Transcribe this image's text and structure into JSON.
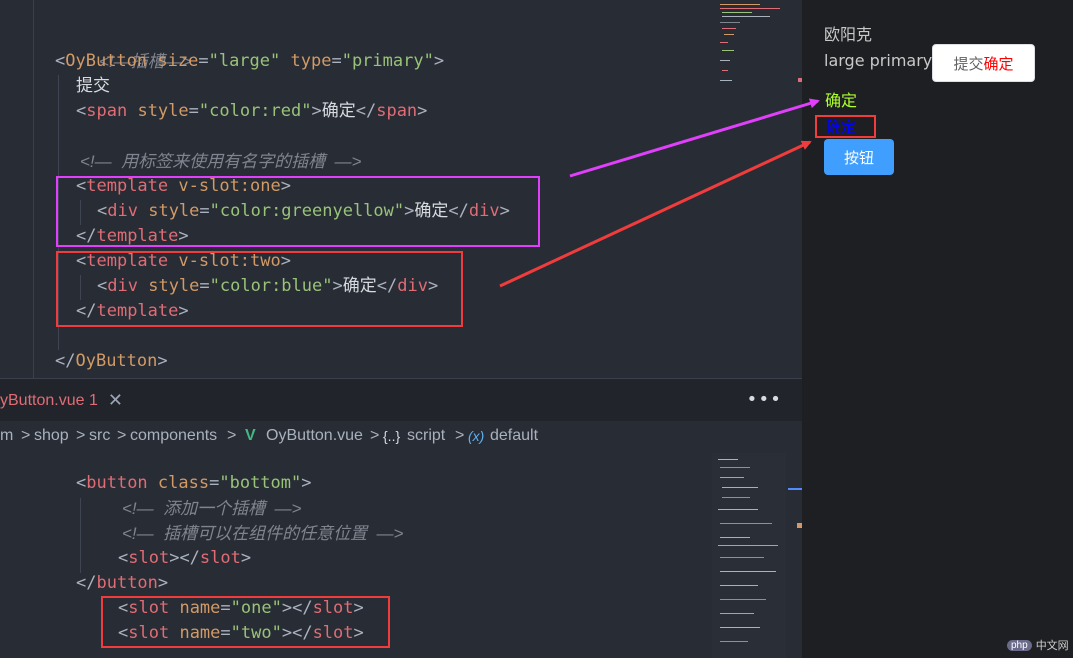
{
  "colors": {
    "tag": "#e06c75",
    "attr": "#d19a66",
    "string": "#98c379",
    "comment": "#7f848e",
    "magenta_box": "#e040fb",
    "red_box": "#f03c3c",
    "button_blue": "#409eff",
    "greenyellow": "#adff2f",
    "blue": "#0000ff"
  },
  "top_editor": {
    "lines": [
      {
        "cmt": "<!—插槽—>"
      },
      {
        "lt": "<",
        "tag": "OyButton",
        "a1": "size",
        "v1": "\"large\"",
        "a2": "type",
        "v2": "\"primary\"",
        "gt": ">"
      },
      {
        "text": "提交"
      },
      {
        "lt": "<",
        "tag": "span",
        "a1": "style",
        "v1": "\"color:red\"",
        "gt": ">",
        "text": "确定",
        "close_lt": "</",
        "close_tag": "span",
        "close_gt": ">"
      },
      {
        "cmt": "<!—  用标签来使用有名字的插槽  —>"
      },
      {
        "lt": "<",
        "tag": "template",
        "a1": "v-slot:one",
        "gt": ">"
      },
      {
        "lt": "<",
        "tag": "div",
        "a1": "style",
        "v1": "\"color:greenyellow\"",
        "gt": ">",
        "text": "确定",
        "close_lt": "</",
        "close_tag": "div",
        "close_gt": ">"
      },
      {
        "close_lt": "</",
        "close_tag": "template",
        "close_gt": ">"
      },
      {
        "lt": "<",
        "tag": "template",
        "a1": "v-slot:two",
        "gt": ">"
      },
      {
        "lt": "<",
        "tag": "div",
        "a1": "style",
        "v1": "\"color:blue\"",
        "gt": ">",
        "text": "确定",
        "close_lt": "</",
        "close_tag": "div",
        "close_gt": ">"
      },
      {
        "close_lt": "</",
        "close_tag": "template",
        "close_gt": ">"
      },
      {
        "close_lt": "</",
        "close_tag": "OyButton",
        "close_gt": ">"
      }
    ]
  },
  "tabbar": {
    "tab_label": "yButton.vue 1",
    "close_glyph": "✕",
    "more_glyph": "•••"
  },
  "breadcrumb": {
    "items": [
      "m",
      "shop",
      "src",
      "components",
      "OyButton.vue",
      "script",
      "default"
    ],
    "sep": ">",
    "vue_glyph": "V",
    "braces_glyph": "{..}",
    "x_glyph": "(x)"
  },
  "bottom_editor": {
    "lines": [
      {
        "lt": "<",
        "tag": "button",
        "a1": "class",
        "v1": "\"bottom\"",
        "gt": ">"
      },
      {
        "cmt": "<!—  添加一个插槽  —>"
      },
      {
        "cmt": "<!—  插槽可以在组件的任意位置  —>"
      },
      {
        "lt": "<",
        "tag": "slot",
        "gt": "></",
        "close_tag": "slot",
        "close_gt": ">"
      },
      {
        "close_lt": "</",
        "close_tag": "button",
        "close_gt": ">"
      },
      {
        "lt": "<",
        "tag": "slot",
        "a1": "name",
        "v1": "\"one\"",
        "gt": "></",
        "close_tag": "slot",
        "close_gt": ">"
      },
      {
        "lt": "<",
        "tag": "slot",
        "a1": "name",
        "v1": "\"two\"",
        "gt": "></",
        "close_tag": "slot",
        "close_gt": ">"
      }
    ]
  },
  "preview": {
    "line1": "欧阳克",
    "line2": "large primary",
    "white_button_text": "提交",
    "white_button_red": "确定",
    "greenyellow_text": "确定",
    "blue_text": "确定",
    "blue_button": "按钮"
  },
  "watermark": {
    "logo": "php",
    "text": "中文网"
  }
}
